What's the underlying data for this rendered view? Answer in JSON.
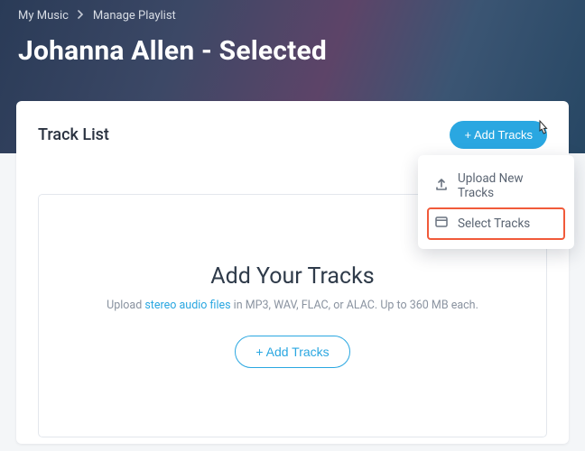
{
  "breadcrumb": {
    "root": "My Music",
    "current": "Manage Playlist"
  },
  "page_title": "Johanna Allen - Selected",
  "card": {
    "title": "Track List",
    "add_button": "+ Add Tracks"
  },
  "dropdown": {
    "upload_label": "Upload New Tracks",
    "select_label": "Select Tracks"
  },
  "dropzone": {
    "heading": "Add Your Tracks",
    "sub_prefix": "Upload ",
    "link_text": "stereo audio files",
    "sub_suffix": " in MP3, WAV, FLAC, or ALAC. Up to 360 MB each.",
    "button": "+ Add Tracks"
  }
}
